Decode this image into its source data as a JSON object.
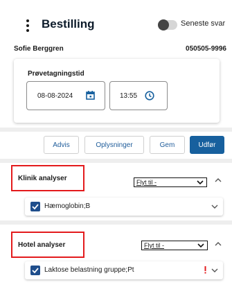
{
  "header": {
    "title": "Bestilling",
    "toggle_label": "Seneste svar"
  },
  "patient": {
    "name": "Sofie Berggren",
    "cpr": "050505-9996"
  },
  "sampling": {
    "label": "Prøvetagningstid",
    "date": "08-08-2024",
    "time": "13:55"
  },
  "actions": {
    "advis": "Advis",
    "oplysninger": "Oplysninger",
    "gem": "Gem",
    "udfor": "Udfør"
  },
  "sections": [
    {
      "title": "Klinik analyser",
      "move_label": "Flyt til -",
      "items": [
        {
          "label": "Hæmoglobin;B",
          "checked": true,
          "warning": false
        }
      ]
    },
    {
      "title": "Hotel analyser",
      "move_label": "Flyt til -",
      "items": [
        {
          "label": "Laktose belastning gruppe;Pt",
          "checked": true,
          "warning": true
        }
      ]
    }
  ],
  "colors": {
    "primary": "#17609e",
    "highlight_border": "#e31a1c",
    "checkbox": "#1f4e8c",
    "warning": "#e31a1c"
  },
  "icons": [
    "kebab-menu-icon",
    "calendar-icon",
    "clock-icon",
    "chevron-down-icon",
    "chevron-up-icon",
    "checkmark-icon",
    "warning-icon"
  ]
}
